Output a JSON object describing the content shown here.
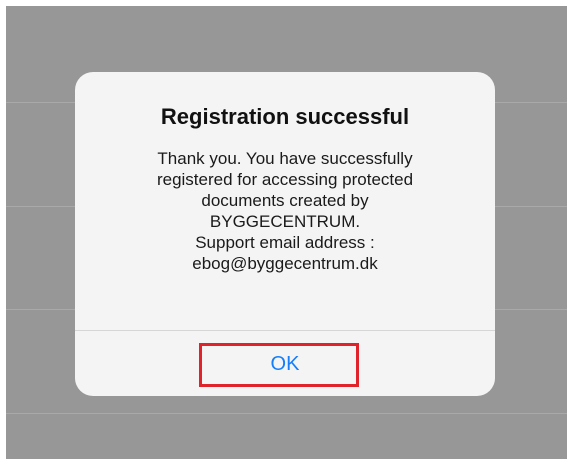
{
  "alert": {
    "title": "Registration successful",
    "message_lines": [
      "Thank you. You have successfully",
      "registered for accessing protected",
      "documents created by",
      "BYGGECENTRUM.",
      "Support email address :",
      "ebog@byggecentrum.dk"
    ],
    "ok_label": "OK"
  },
  "colors": {
    "backdrop": "#979797",
    "alert_background": "#f4f4f4",
    "button_text": "#147efb",
    "highlight": "#e0232b"
  }
}
